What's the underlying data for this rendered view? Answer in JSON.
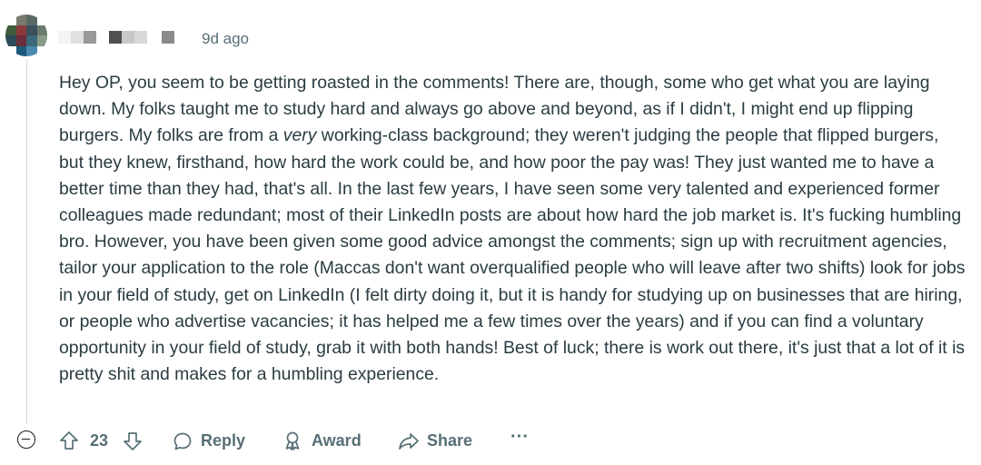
{
  "comment": {
    "timestamp": "9d ago",
    "body_parts": [
      "Hey OP, you seem to be getting roasted in the comments! There are, though, some who get what you are laying down. My folks taught me to study hard and always go above and beyond, as if I didn't, I might end up flipping burgers. My folks are from a ",
      "very",
      " working-class background; they weren't judging the people that flipped burgers, but they knew, firsthand, how hard the work could be, and how poor the pay was! They just wanted me to have a better time than they had, that's all. In the last few years, I have seen some very talented and experienced former colleagues made redundant; most of their LinkedIn posts are about how hard the job market is. It's fucking humbling bro. However, you have been given some good advice amongst the comments; sign up with recruitment agencies, tailor your application to the role (Maccas don't want overqualified people who will leave after two shifts) look for jobs in your field of study, get on LinkedIn (I felt dirty doing it, but it is handy for studying up on businesses that are hiring, or people who advertise vacancies; it has helped me a few times over the years) and if you can find a voluntary opportunity in your field of study, grab it with both hands! Best of luck; there is work out there, it's just that a lot of it is pretty shit and makes for a humbling experience."
    ]
  },
  "actions": {
    "vote_count": "23",
    "reply_label": "Reply",
    "award_label": "Award",
    "share_label": "Share",
    "more_label": "···"
  },
  "icons": {
    "collapse": "collapse-icon",
    "upvote": "upvote-icon",
    "downvote": "downvote-icon",
    "reply": "reply-icon",
    "award": "award-icon",
    "share": "share-icon",
    "more": "more-icon"
  }
}
